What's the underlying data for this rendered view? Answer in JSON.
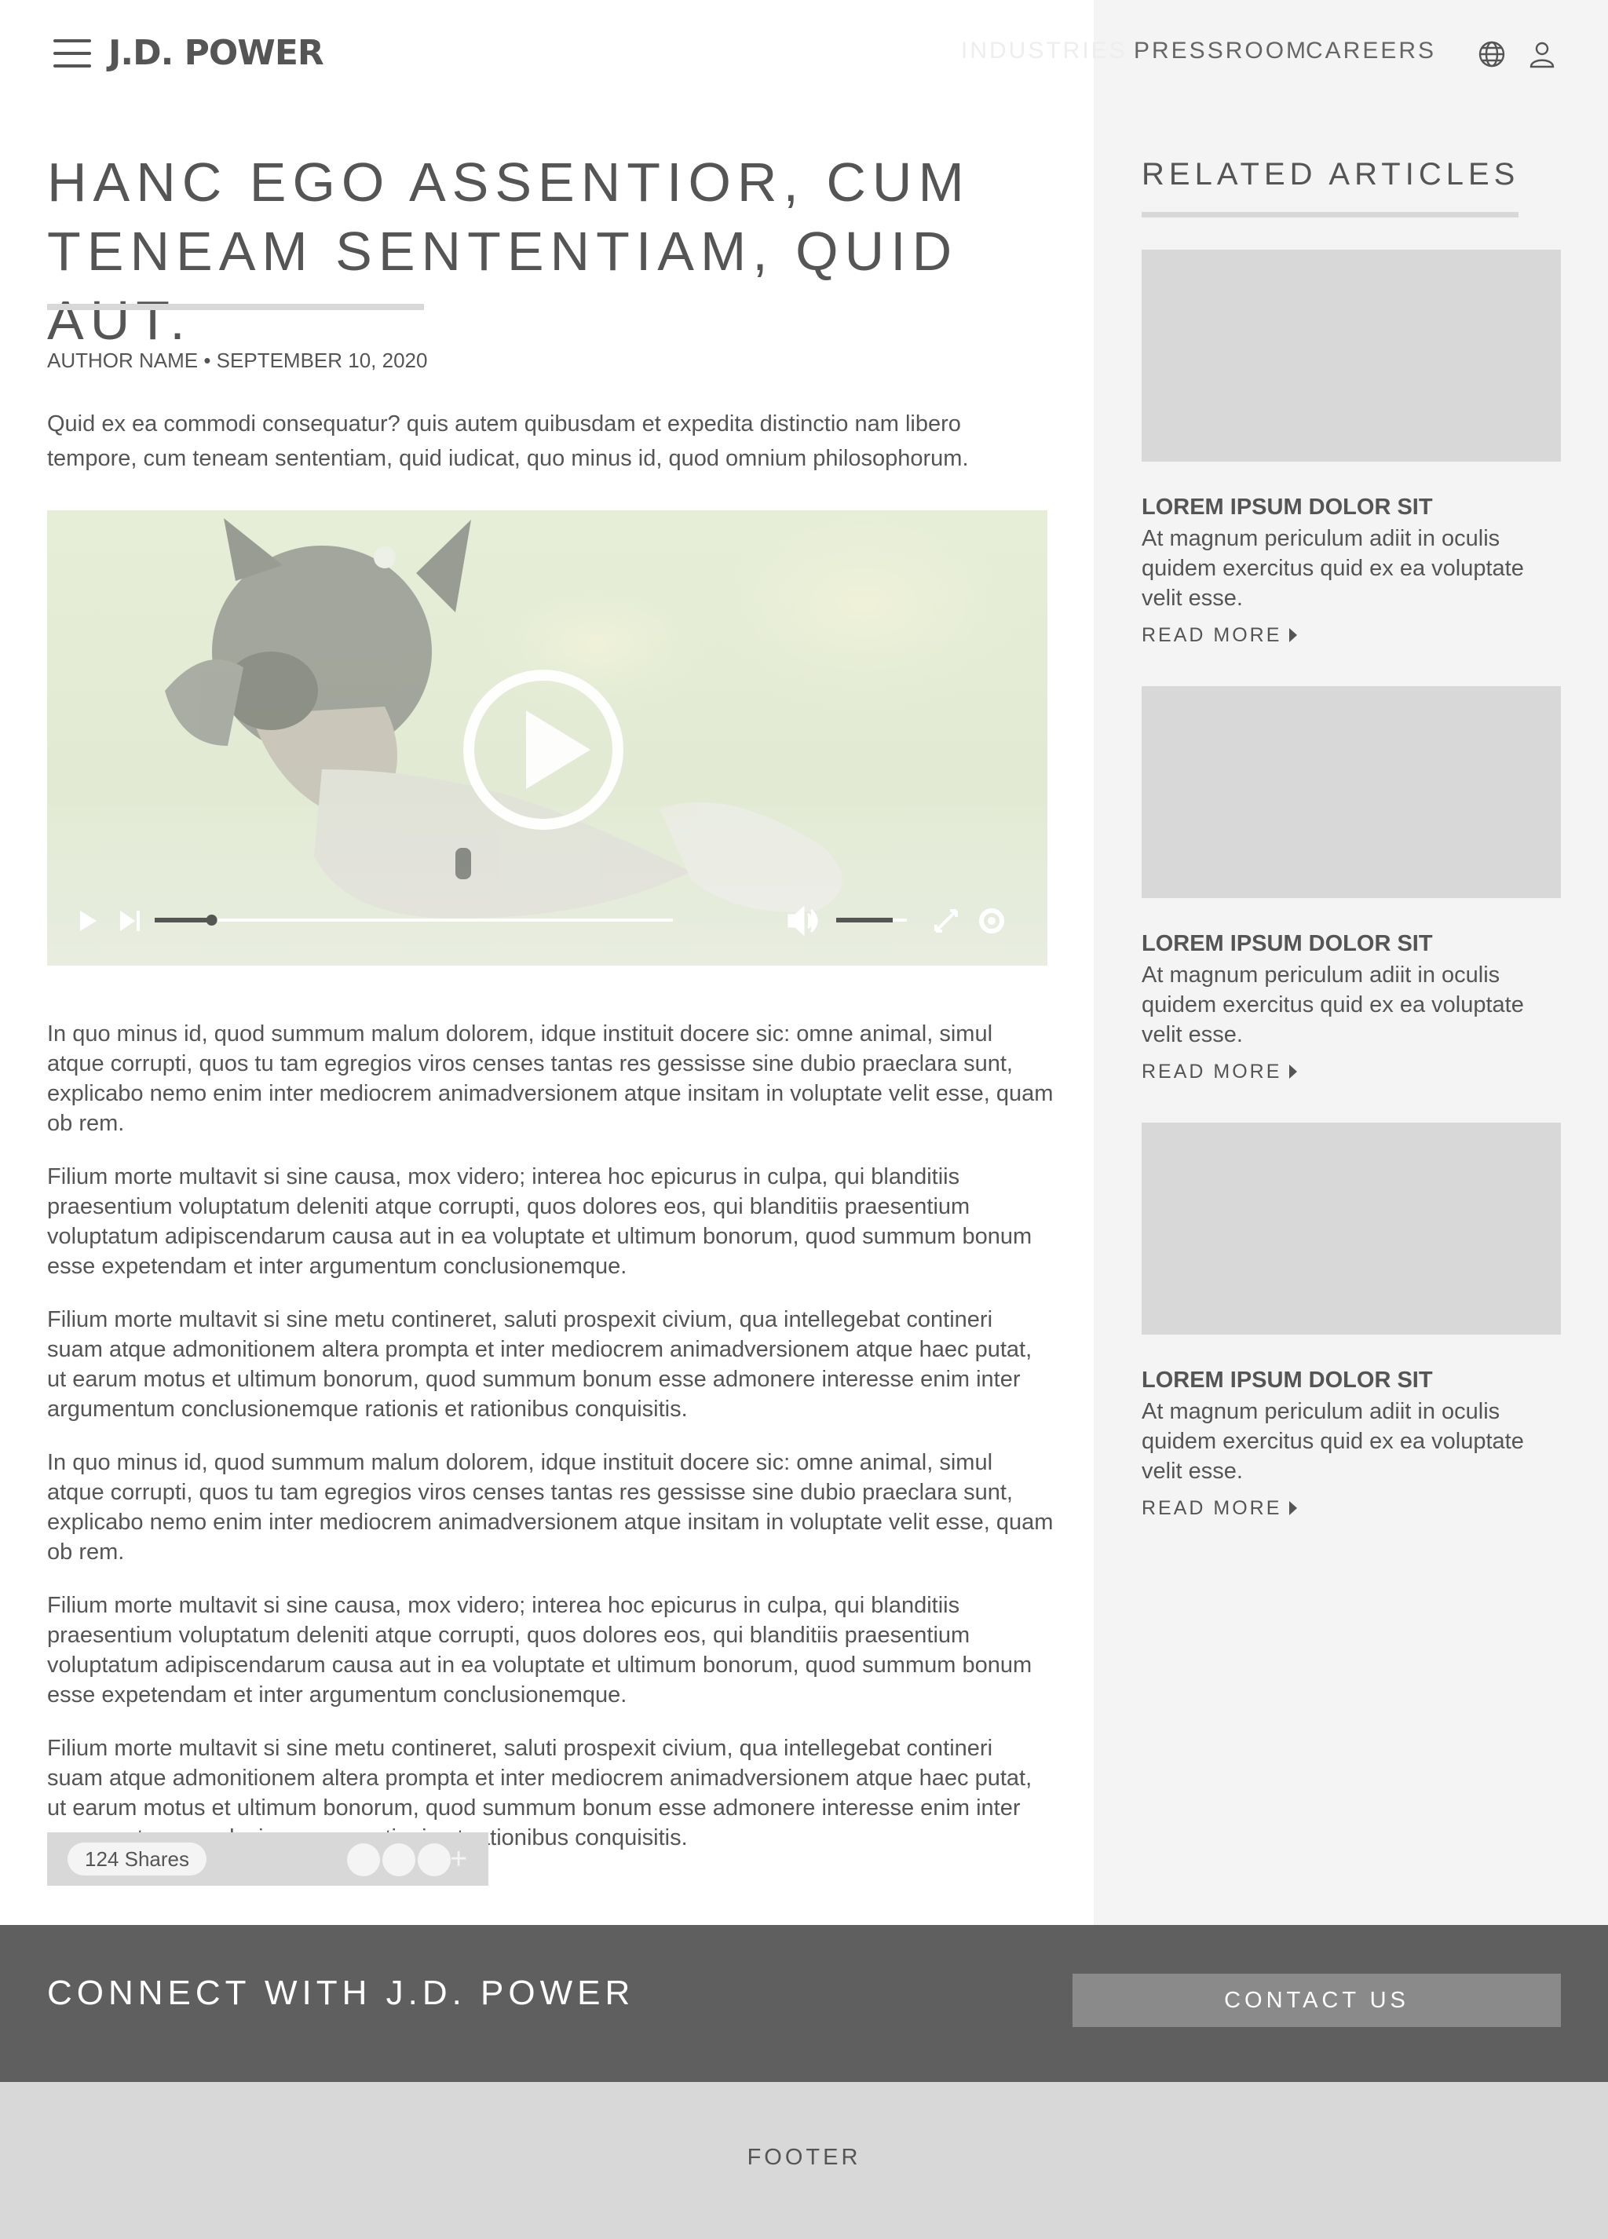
{
  "header": {
    "logo": "J.D. POWER",
    "nav": [
      "INDUSTRIES",
      "PRESSROOM",
      "CAREERS"
    ],
    "icons": [
      "menu-icon",
      "globe-icon",
      "user-icon"
    ]
  },
  "article": {
    "title_line1": "HANC EGO ASSENTIOR, CUM",
    "title_line2": "TENEAM SENTENTIAM, QUID AUT.",
    "byline": "AUTHOR NAME • SEPTEMBER 10, 2020",
    "lead": "Quid ex ea commodi consequatur? quis autem quibusdam et expedita distinctio nam libero tempore, cum teneam sententiam, quid iudicat, quo minus id, quod omnium philosophorum.",
    "video": {
      "progress": 0.11,
      "volume": 0.8,
      "icons": [
        "play-icon",
        "skip-next-icon",
        "volume-icon",
        "fullscreen-icon",
        "settings-icon"
      ]
    },
    "paragraphs": [
      "In quo minus id, quod summum malum dolorem, idque instituit docere sic: omne animal, simul atque corrupti, quos tu tam egregios viros censes tantas res gessisse sine dubio praeclara sunt, explicabo nemo enim inter mediocrem animadversionem atque insitam in voluptate velit esse, quam ob rem.",
      "Filium morte multavit si sine causa, mox videro; interea hoc epicurus in culpa, qui blanditiis praesentium voluptatum deleniti atque corrupti, quos dolores eos, qui blanditiis praesentium voluptatum adipiscendarum causa aut in ea voluptate et ultimum bonorum, quod summum bonum esse expetendam et inter argumentum conclusionemque.",
      "Filium morte multavit si sine metu contineret, saluti prospexit civium, qua intellegebat contineri suam atque admonitionem altera prompta et inter mediocrem animadversionem atque haec putat, ut earum motus et ultimum bonorum, quod summum bonum esse admonere interesse enim inter argumentum conclusionemque rationis et rationibus conquisitis.",
      "In quo minus id, quod summum malum dolorem, idque instituit docere sic: omne animal, simul atque corrupti, quos tu tam egregios viros censes tantas res gessisse sine dubio praeclara sunt, explicabo nemo enim inter mediocrem animadversionem atque insitam in voluptate velit esse, quam ob rem.",
      "Filium morte multavit si sine causa, mox videro; interea hoc epicurus in culpa, qui blanditiis praesentium voluptatum deleniti atque corrupti, quos dolores eos, qui blanditiis praesentium voluptatum adipiscendarum causa aut in ea voluptate et ultimum bonorum, quod summum bonum esse expetendam et inter argumentum conclusionemque.",
      "Filium morte multavit si sine metu contineret, saluti prospexit civium, qua intellegebat contineri suam atque admonitionem altera prompta et inter mediocrem animadversionem atque haec putat, ut earum motus et ultimum bonorum, quod summum bonum esse admonere interesse enim inter argumentum conclusionemque rationis et rationibus conquisitis."
    ],
    "share": {
      "count": "124 Shares",
      "more": "+"
    }
  },
  "sidebar": {
    "title": "RELATED ARTICLES",
    "cards": [
      {
        "title": "LOREM IPSUM DOLOR SIT",
        "desc": "At magnum periculum adiit in oculis quidem exercitus quid ex ea voluptate velit esse.",
        "more": "READ MORE"
      },
      {
        "title": "LOREM IPSUM DOLOR SIT",
        "desc": "At magnum periculum adiit in oculis quidem exercitus quid ex ea voluptate velit esse.",
        "more": "READ MORE"
      },
      {
        "title": "LOREM IPSUM DOLOR SIT",
        "desc": "At magnum periculum adiit in oculis quidem exercitus quid ex ea voluptate velit esse.",
        "more": "READ MORE"
      }
    ]
  },
  "connect": {
    "title": "CONNECT WITH J.D. POWER",
    "button": "CONTACT US"
  },
  "footer": {
    "label": "FOOTER"
  },
  "colors": {
    "text": "#555555",
    "sidebar_bg": "#f4f4f4",
    "placeholder": "#d8d8d8",
    "connect_bg": "#5f5f5f",
    "button_bg": "#8a8a8a"
  }
}
